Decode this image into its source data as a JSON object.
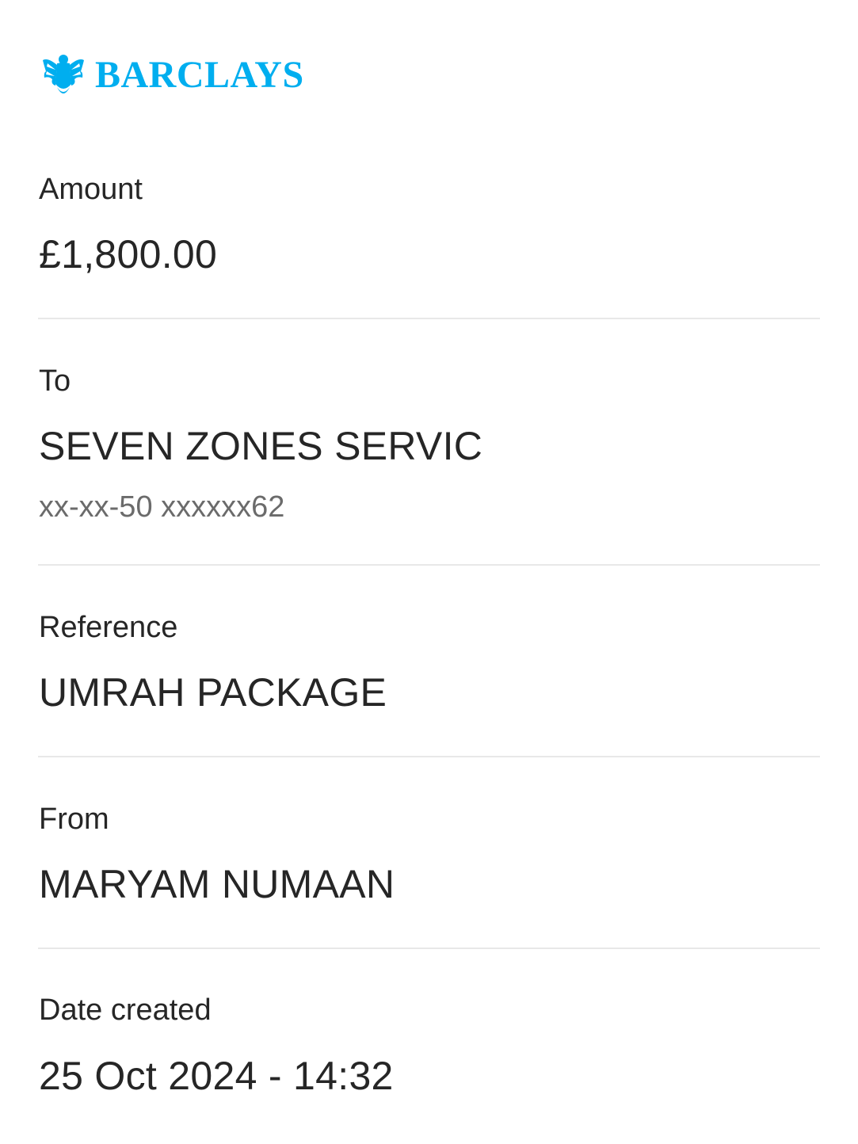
{
  "brand": {
    "name": "BARCLAYS",
    "color": "#00AEEF",
    "icon": "eagle-icon"
  },
  "amount": {
    "label": "Amount",
    "value": "£1,800.00"
  },
  "to": {
    "label": "To",
    "name": "SEVEN ZONES SERVIC",
    "account": "xx-xx-50 xxxxxx62"
  },
  "reference": {
    "label": "Reference",
    "value": "UMRAH PACKAGE"
  },
  "from": {
    "label": "From",
    "value": "MARYAM NUMAAN"
  },
  "date_created": {
    "label": "Date created",
    "value": "25 Oct 2024 - 14:32"
  }
}
